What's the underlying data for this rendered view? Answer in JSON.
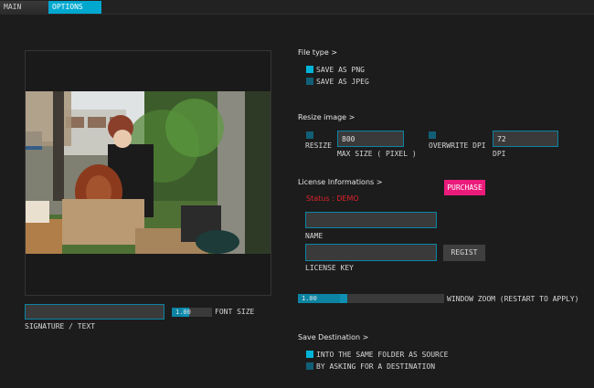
{
  "tabs": {
    "main": "MAIN",
    "options": "OPTIONS"
  },
  "preview": {
    "signature_value": "",
    "signature_label": "SIGNATURE / TEXT",
    "font_size": {
      "label": "FONT SIZE",
      "value": "1.00",
      "level": 0.3
    }
  },
  "file_type": {
    "heading": "File type >",
    "options": [
      {
        "label": "SAVE AS PNG",
        "checked": true
      },
      {
        "label": "SAVE AS JPEG",
        "checked": false
      }
    ]
  },
  "resize": {
    "heading": "Resize image >",
    "resize_label": "RESIZE",
    "resize_checked": false,
    "max_size_value": "800",
    "max_size_label": "MAX SIZE ( PIXEL )",
    "overwrite_dpi_label": "OVERWRITE DPI",
    "overwrite_dpi_checked": false,
    "dpi_value": "72",
    "dpi_label": "DPI"
  },
  "license": {
    "heading": "License Informations >",
    "status": "Status : DEMO",
    "purchase_label": "PURCHASE",
    "name_value": "",
    "name_label": "NAME",
    "key_value": "",
    "key_label": "LICENSE KEY",
    "regist_label": "REGIST"
  },
  "window_zoom": {
    "value": "1.00",
    "label": "WINDOW ZOOM (RESTART TO APPLY)",
    "level": 0.3
  },
  "save_destination": {
    "heading": "Save Destination >",
    "options": [
      {
        "label": "INTO THE SAME FOLDER AS SOURCE",
        "checked": true
      },
      {
        "label": "BY ASKING FOR A DESTINATION",
        "checked": false
      }
    ]
  },
  "colors": {
    "accent": "#00b4d8",
    "purchase": "#ea1b7b",
    "status": "#e1232b",
    "background": "#1c1c1c"
  }
}
